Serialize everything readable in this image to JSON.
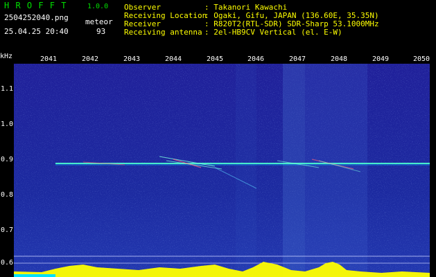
{
  "header": {
    "app_name": "H R O F F T",
    "version": "1.0.0",
    "filename": "2504252040.png",
    "datetime": "25.04.25 20:40",
    "meteor_label": "meteor",
    "meteor_count": "93",
    "fields": [
      {
        "key": "Observer",
        "value": ": Takanori Kawachi"
      },
      {
        "key": "Receiving Location",
        "value": ": Ogaki, Gifu, JAPAN (136.60E, 35.35N)"
      },
      {
        "key": "Receiver",
        "value": ": R820T2(RTL-SDR) SDR-Sharp 53.1000MHz"
      },
      {
        "key": "Receiving antenna",
        "value": ": 2el-HB9CV Vertical (el. E-W)"
      }
    ]
  },
  "axis": {
    "unit": "kHz",
    "x_ticks": [
      "2041",
      "2042",
      "2043",
      "2044",
      "2045",
      "2046",
      "2047",
      "2048",
      "2049",
      "2050"
    ],
    "y_ticks": [
      "1.1",
      "1.0",
      "0.9",
      "0.8",
      "0.7",
      "0.6"
    ]
  },
  "colors": {
    "background": "#1a1a8a",
    "header_green": "#00e000",
    "header_yellow": "#ffff00",
    "signal_line": "#00ffb0",
    "baseline_bar": "#ffff00"
  }
}
